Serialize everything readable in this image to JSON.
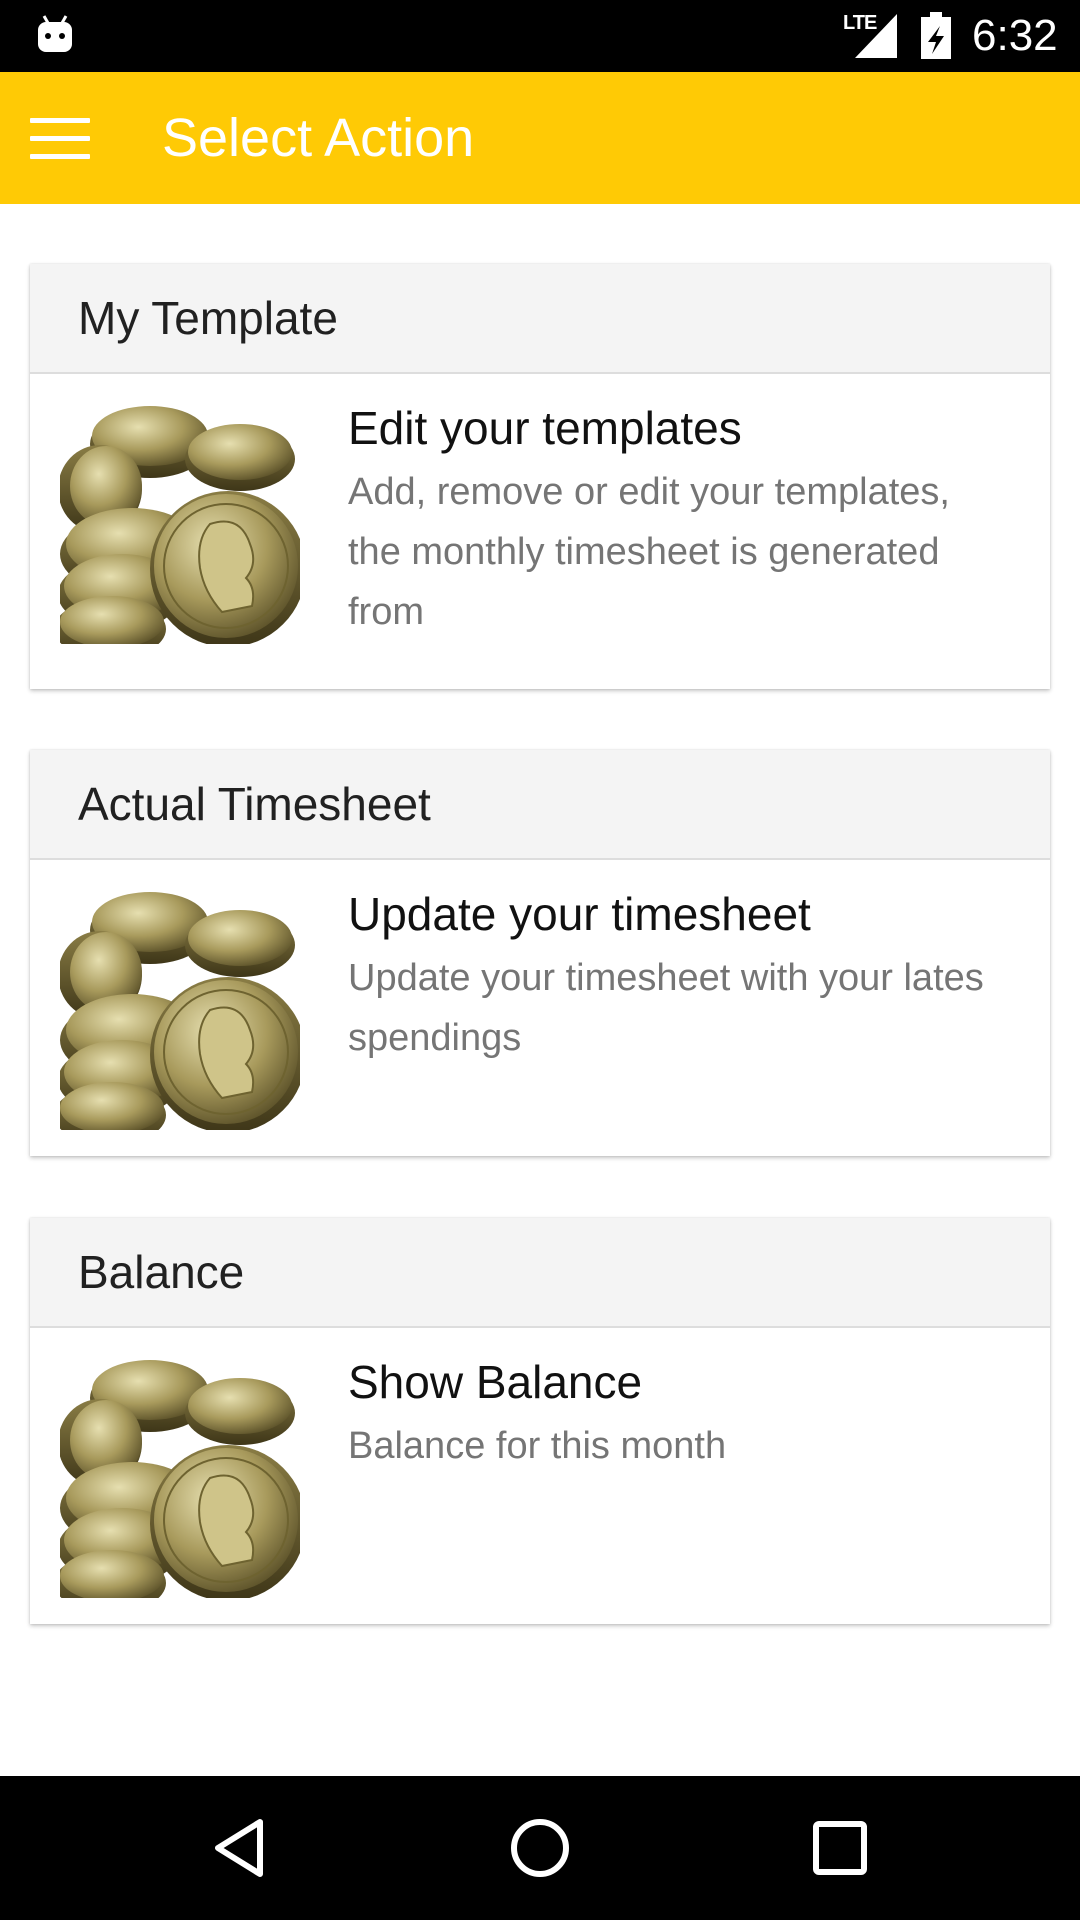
{
  "status_bar": {
    "network": "LTE",
    "time": "6:32",
    "icons": [
      "android-notification-icon",
      "signal-icon",
      "battery-charging-icon"
    ]
  },
  "app_bar": {
    "title": "Select Action",
    "color": "#FFCA05",
    "menu_icon": "hamburger-menu-icon"
  },
  "cards": [
    {
      "header": "My Template",
      "title": "Edit your templates",
      "description": "Add, remove or edit your templates, the monthly timesheet is generated from",
      "image": "coins-image"
    },
    {
      "header": "Actual Timesheet",
      "title": "Update your timesheet",
      "description": "Update your timesheet with your lates spendings",
      "image": "coins-image"
    },
    {
      "header": "Balance",
      "title": "Show Balance",
      "description": "Balance for this month",
      "image": "coins-image"
    }
  ],
  "nav_bar": {
    "icons": [
      "back-icon",
      "home-icon",
      "recents-icon"
    ]
  }
}
